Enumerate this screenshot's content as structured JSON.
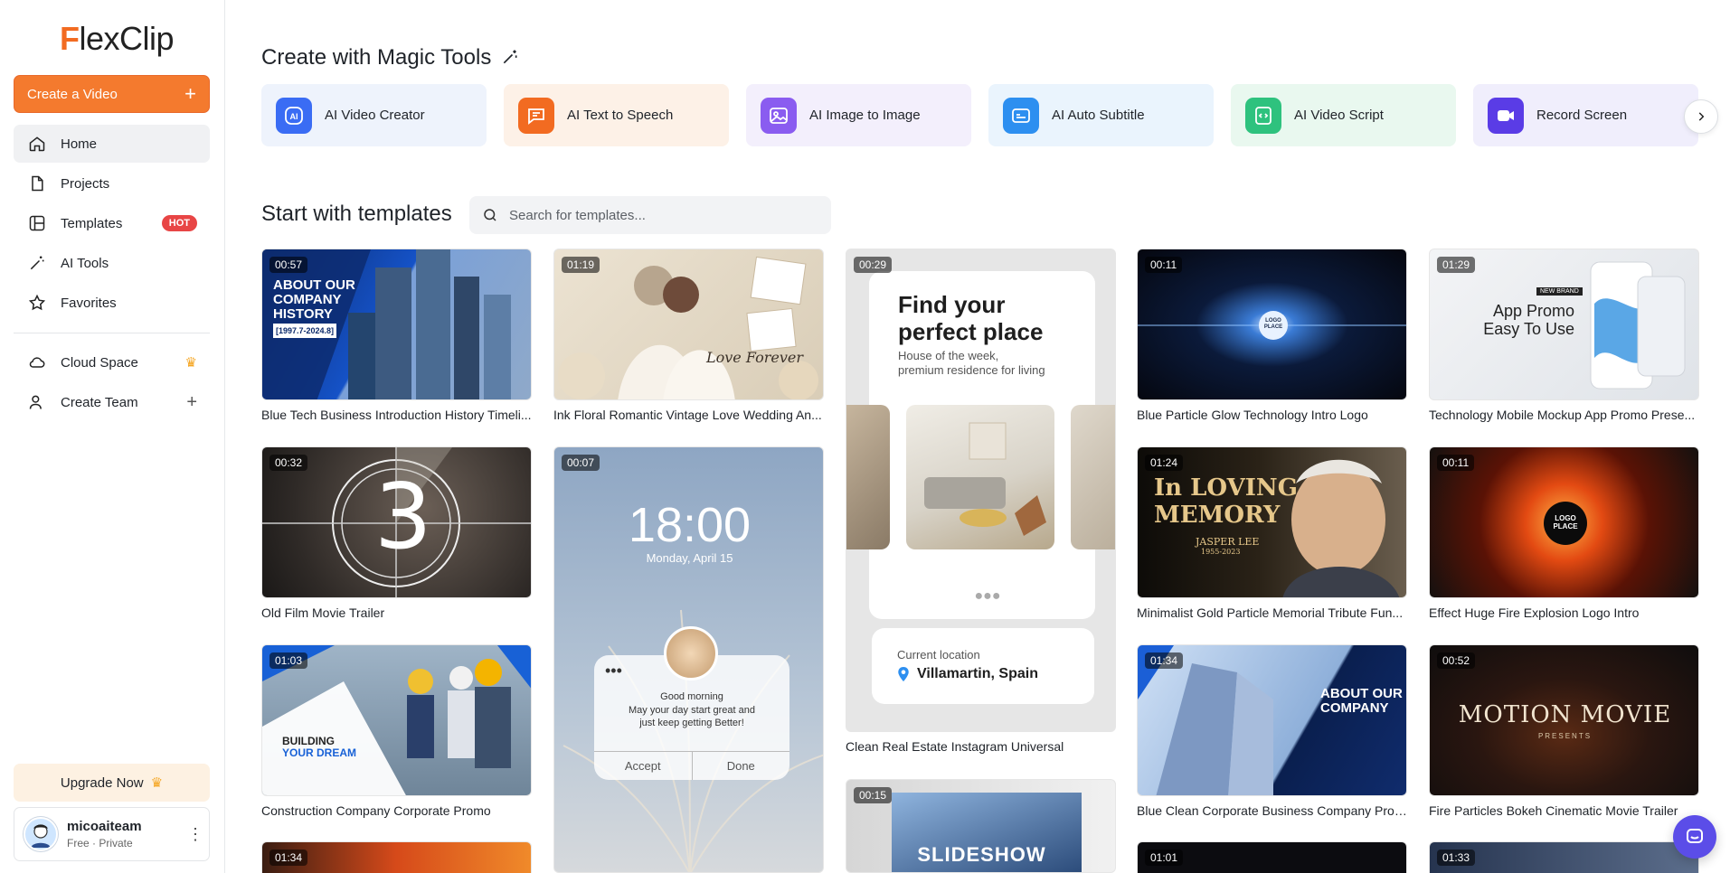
{
  "app": {
    "logo_text": "lexClip",
    "logo_initial": "F",
    "accent": "#f47a2e"
  },
  "sidebar": {
    "create_label": "Create a Video",
    "items": [
      {
        "label": "Home",
        "icon": "home-icon"
      },
      {
        "label": "Projects",
        "icon": "document-icon"
      },
      {
        "label": "Templates",
        "icon": "templates-icon",
        "badge": "HOT"
      },
      {
        "label": "AI Tools",
        "icon": "magic-wand-icon"
      },
      {
        "label": "Favorites",
        "icon": "star-icon"
      }
    ],
    "secondary": [
      {
        "label": "Cloud Space",
        "icon": "cloud-icon"
      },
      {
        "label": "Create Team",
        "icon": "add-user-icon"
      }
    ],
    "upgrade_label": "Upgrade Now",
    "user": {
      "name": "micoaiteam",
      "plan": "Free · Private"
    }
  },
  "magic": {
    "heading": "Create with Magic Tools",
    "tools": [
      {
        "label": "AI Video Creator",
        "bg": "#eef3fc",
        "icon_bg": "#3a6cf4"
      },
      {
        "label": "AI Text to Speech",
        "bg": "#fdf1e7",
        "icon_bg": "#f26b21"
      },
      {
        "label": "AI Image to Image",
        "bg": "#f3effc",
        "icon_bg": "#8a5cf0"
      },
      {
        "label": "AI Auto Subtitle",
        "bg": "#eaf4fd",
        "icon_bg": "#2d8ff0"
      },
      {
        "label": "AI Video Script",
        "bg": "#e9f8ef",
        "icon_bg": "#2ec27e"
      },
      {
        "label": "Record Screen",
        "bg": "#f0eefc",
        "icon_bg": "#5a3ce6"
      }
    ]
  },
  "templates": {
    "heading": "Start with templates",
    "search_placeholder": "Search for templates...",
    "cards": [
      {
        "duration": "00:57",
        "title": "Blue Tech Business Introduction History Timeli..."
      },
      {
        "duration": "01:19",
        "title": "Ink Floral Romantic Vintage Love Wedding An..."
      },
      {
        "duration": "00:29",
        "title": "Clean Real Estate Instagram Universal"
      },
      {
        "duration": "00:11",
        "title": "Blue Particle Glow Technology Intro Logo"
      },
      {
        "duration": "01:29",
        "title": "Technology Mobile Mockup App Promo Prese..."
      },
      {
        "duration": "00:32",
        "title": "Old Film Movie Trailer"
      },
      {
        "duration": "00:07",
        "title": ""
      },
      {
        "duration": "01:24",
        "title": "Minimalist Gold Particle Memorial Tribute Fun..."
      },
      {
        "duration": "00:11",
        "title": "Effect Huge Fire Explosion Logo Intro"
      },
      {
        "duration": "01:03",
        "title": "Construction Company Corporate Promo"
      },
      {
        "duration": "01:34",
        "title": "Blue Clean Corporate Business Company Profi..."
      },
      {
        "duration": "00:52",
        "title": "Fire Particles Bokeh Cinematic Movie Trailer"
      },
      {
        "duration": "01:34",
        "title": ""
      },
      {
        "duration": "00:15",
        "title": ""
      },
      {
        "duration": "01:01",
        "title": ""
      },
      {
        "duration": "01:33",
        "title": ""
      }
    ],
    "thumb_text": {
      "t1": [
        "ABOUT OUR",
        "COMPANY",
        "HISTORY",
        "[1997.7-2024.8]"
      ],
      "t2": [
        "Love Forever"
      ],
      "t3": {
        "h1": "Find your",
        "h2": "perfect place",
        "sub1": "House of the week,",
        "sub2": "premium residence for living",
        "loc_label": "Current location",
        "loc": "Villamartin, Spain"
      },
      "t4": [
        "LOGO",
        "PLACE"
      ],
      "t5": {
        "tag": "NEW BRAND",
        "h1": "App Promo",
        "h2": "Easy To Use"
      },
      "t6": [
        "3"
      ],
      "t7": {
        "time": "18:00",
        "date": "Monday, April 15",
        "msg1": "Good morning",
        "msg2": "May your day start great and",
        "msg3": "just keep getting Better!",
        "accept": "Accept",
        "done": "Done"
      },
      "t8": {
        "l1": "In LOVING",
        "l2": "MEMORY",
        "name": "JASPER LEE",
        "dates": "1955-2023"
      },
      "t9": [
        "LOGO",
        "PLACE"
      ],
      "t10": [
        "BUILDING",
        "YOUR DREAM"
      ],
      "t11": [
        "ABOUT OUR",
        "COMPANY"
      ],
      "t12": {
        "title": "MOTION MOVIE",
        "sub": "PRESENTS"
      },
      "t14": "SLIDESHOW"
    }
  }
}
